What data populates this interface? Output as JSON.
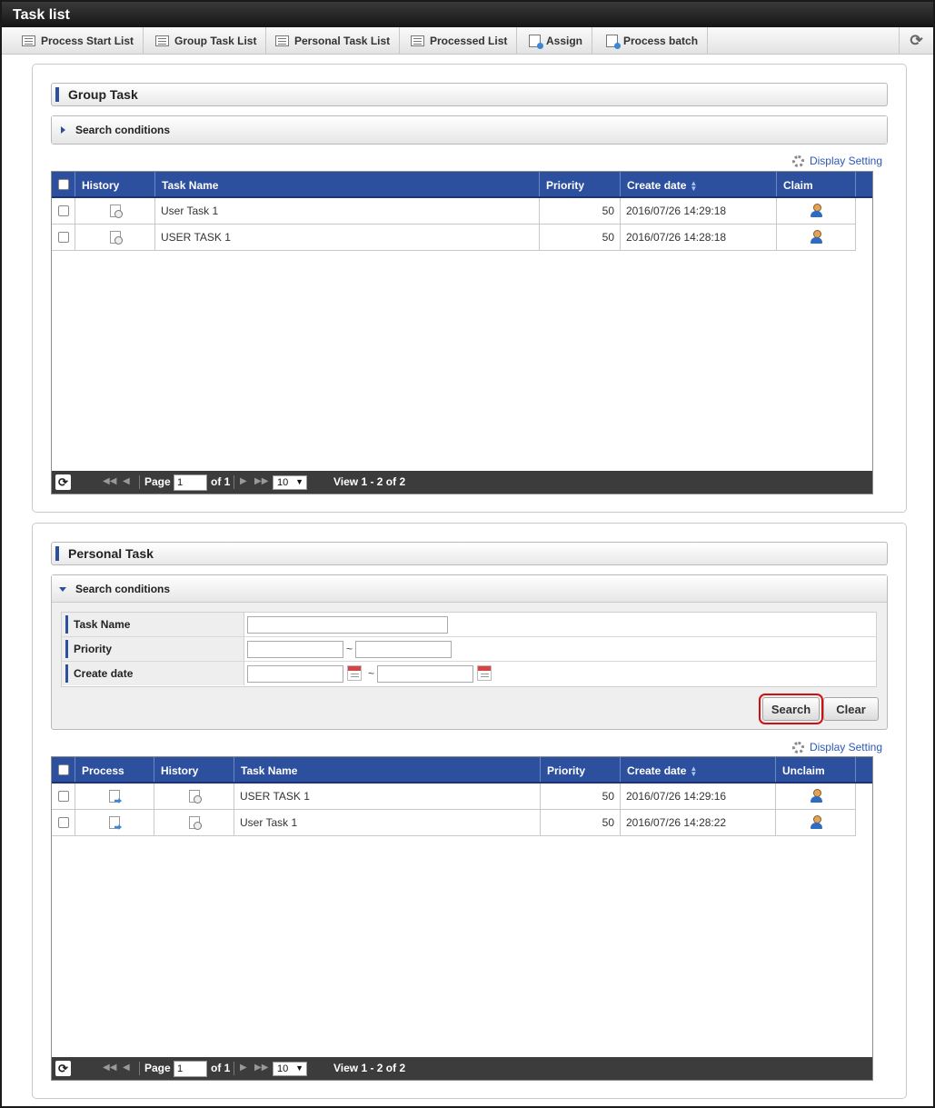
{
  "title": "Task list",
  "toolbar": {
    "buttons": [
      {
        "label": "Process Start List",
        "icon": "list-icon"
      },
      {
        "label": "Group Task List",
        "icon": "list-icon"
      },
      {
        "label": "Personal Task List",
        "icon": "list-icon"
      },
      {
        "label": "Processed List",
        "icon": "list-icon"
      },
      {
        "label": "Assign",
        "icon": "assign-doc-icon"
      },
      {
        "label": "Process batch",
        "icon": "batch-doc-icon"
      }
    ],
    "refresh_icon": "refresh-icon"
  },
  "group_task": {
    "title": "Group Task",
    "search_conditions": "Search conditions",
    "display_setting": "Display Setting",
    "columns": [
      "History",
      "Task Name",
      "Priority",
      "Create date",
      "Claim"
    ],
    "rows": [
      {
        "task_name": "User Task 1",
        "priority": "50",
        "create_date": "2016/07/26 14:29:18"
      },
      {
        "task_name": "USER TASK 1",
        "priority": "50",
        "create_date": "2016/07/26 14:28:18"
      }
    ],
    "pager": {
      "page_label": "Page",
      "page_value": "1",
      "of_label": "of 1",
      "per_page": "10",
      "view_text": "View 1 - 2 of 2"
    }
  },
  "personal_task": {
    "title": "Personal Task",
    "search_conditions": "Search conditions",
    "conditions": {
      "task_name_label": "Task Name",
      "priority_label": "Priority",
      "create_date_label": "Create date",
      "range_sep": "~"
    },
    "search_button": "Search",
    "clear_button": "Clear",
    "display_setting": "Display Setting",
    "columns": [
      "Process",
      "History",
      "Task Name",
      "Priority",
      "Create date",
      "Unclaim"
    ],
    "rows": [
      {
        "task_name": "USER TASK 1",
        "priority": "50",
        "create_date": "2016/07/26 14:29:16"
      },
      {
        "task_name": "User Task 1",
        "priority": "50",
        "create_date": "2016/07/26 14:28:22"
      }
    ],
    "pager": {
      "page_label": "Page",
      "page_value": "1",
      "of_label": "of 1",
      "per_page": "10",
      "view_text": "View 1 - 2 of 2"
    }
  },
  "colors": {
    "header_blue": "#2c4f9e",
    "pager_bg": "#3c3c3c",
    "focus_outline": "#d01010",
    "link": "#2e58b5"
  }
}
